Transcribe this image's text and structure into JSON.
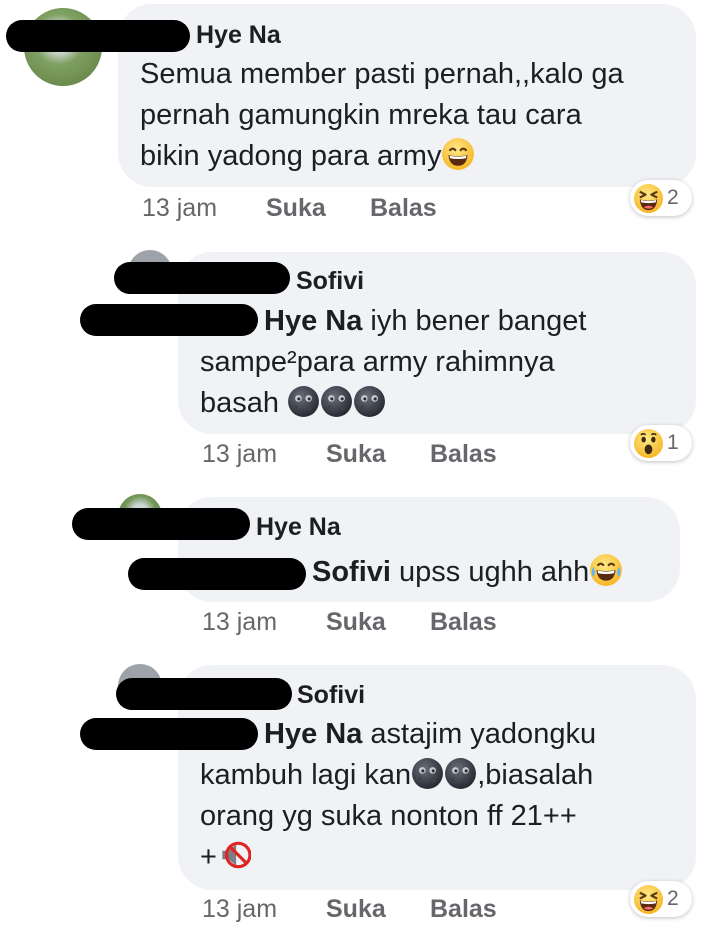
{
  "comments": [
    {
      "author": "Hye Na",
      "lines": [
        "Semua member pasti pernah,,kalo ga",
        "pernah gamungkin mreka tau cara",
        "bikin yadong para army"
      ],
      "time": "13 jam",
      "like": "Suka",
      "reply": "Balas",
      "reaction": {
        "icon": "laughing-squint-emoji",
        "count": "2"
      }
    },
    {
      "author": "Sofivi",
      "mention": "Hye Na",
      "lines": [
        "iyh bener banget",
        "sampe²para army rahimnya",
        "basah"
      ],
      "time": "13 jam",
      "like": "Suka",
      "reply": "Balas",
      "reaction": {
        "icon": "wow-emoji",
        "count": "1"
      }
    },
    {
      "author": "Hye Na",
      "mention": "Sofivi",
      "lines": [
        "upss ughh ahh"
      ],
      "time": "13 jam",
      "like": "Suka",
      "reply": "Balas"
    },
    {
      "author": "Sofivi",
      "mention": "Hye Na",
      "lines": [
        "astajim yadongku",
        "kambuh lagi kan",
        ",biasalah",
        "orang yg suka nonton ff 21++",
        "+"
      ],
      "time": "13 jam",
      "like": "Suka",
      "reply": "Balas",
      "reaction": {
        "icon": "laughing-squint-emoji",
        "count": "2"
      }
    }
  ],
  "colors": {
    "bubble": "#f0f2f5",
    "meta": "#65676b",
    "text": "#1c1e21"
  }
}
